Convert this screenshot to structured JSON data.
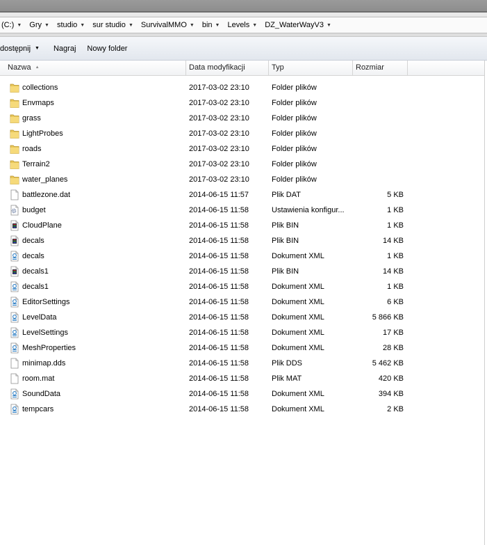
{
  "address": {
    "crumbs": [
      "(C:)",
      "Gry",
      "studio",
      "sur studio",
      "SurvivalMMO",
      "bin",
      "Levels",
      "DZ_WaterWayV3"
    ]
  },
  "toolbar": {
    "share_label": "dostępnij",
    "burn_label": "Nagraj",
    "new_folder_label": "Nowy folder"
  },
  "columns": {
    "name": "Nazwa",
    "date": "Data modyfikacji",
    "type": "Typ",
    "size": "Rozmiar"
  },
  "files": [
    {
      "name": "collections",
      "date": "2017-03-02 23:10",
      "type": "Folder plików",
      "size": "",
      "icon": "folder-icon"
    },
    {
      "name": "Envmaps",
      "date": "2017-03-02 23:10",
      "type": "Folder plików",
      "size": "",
      "icon": "folder-icon"
    },
    {
      "name": "grass",
      "date": "2017-03-02 23:10",
      "type": "Folder plików",
      "size": "",
      "icon": "folder-icon"
    },
    {
      "name": "LightProbes",
      "date": "2017-03-02 23:10",
      "type": "Folder plików",
      "size": "",
      "icon": "folder-icon"
    },
    {
      "name": "roads",
      "date": "2017-03-02 23:10",
      "type": "Folder plików",
      "size": "",
      "icon": "folder-icon"
    },
    {
      "name": "Terrain2",
      "date": "2017-03-02 23:10",
      "type": "Folder plików",
      "size": "",
      "icon": "folder-icon"
    },
    {
      "name": "water_planes",
      "date": "2017-03-02 23:10",
      "type": "Folder plików",
      "size": "",
      "icon": "folder-icon"
    },
    {
      "name": "battlezone.dat",
      "date": "2014-06-15 11:57",
      "type": "Plik DAT",
      "size": "5 KB",
      "icon": "file-icon"
    },
    {
      "name": "budget",
      "date": "2014-06-15 11:58",
      "type": "Ustawienia konfigur...",
      "size": "1 KB",
      "icon": "config-file-icon"
    },
    {
      "name": "CloudPlane",
      "date": "2014-06-15 11:58",
      "type": "Plik BIN",
      "size": "1 KB",
      "icon": "bin-file-icon"
    },
    {
      "name": "decals",
      "date": "2014-06-15 11:58",
      "type": "Plik BIN",
      "size": "14 KB",
      "icon": "bin-file-icon"
    },
    {
      "name": "decals",
      "date": "2014-06-15 11:58",
      "type": "Dokument XML",
      "size": "1 KB",
      "icon": "xml-file-icon"
    },
    {
      "name": "decals1",
      "date": "2014-06-15 11:58",
      "type": "Plik BIN",
      "size": "14 KB",
      "icon": "bin-file-icon"
    },
    {
      "name": "decals1",
      "date": "2014-06-15 11:58",
      "type": "Dokument XML",
      "size": "1 KB",
      "icon": "xml-file-icon"
    },
    {
      "name": "EditorSettings",
      "date": "2014-06-15 11:58",
      "type": "Dokument XML",
      "size": "6 KB",
      "icon": "xml-file-icon"
    },
    {
      "name": "LevelData",
      "date": "2014-06-15 11:58",
      "type": "Dokument XML",
      "size": "5 866 KB",
      "icon": "xml-file-icon"
    },
    {
      "name": "LevelSettings",
      "date": "2014-06-15 11:58",
      "type": "Dokument XML",
      "size": "17 KB",
      "icon": "xml-file-icon"
    },
    {
      "name": "MeshProperties",
      "date": "2014-06-15 11:58",
      "type": "Dokument XML",
      "size": "28 KB",
      "icon": "xml-file-icon"
    },
    {
      "name": "minimap.dds",
      "date": "2014-06-15 11:58",
      "type": "Plik DDS",
      "size": "5 462 KB",
      "icon": "file-icon"
    },
    {
      "name": "room.mat",
      "date": "2014-06-15 11:58",
      "type": "Plik MAT",
      "size": "420 KB",
      "icon": "file-icon"
    },
    {
      "name": "SoundData",
      "date": "2014-06-15 11:58",
      "type": "Dokument XML",
      "size": "394 KB",
      "icon": "xml-file-icon"
    },
    {
      "name": "tempcars",
      "date": "2014-06-15 11:58",
      "type": "Dokument XML",
      "size": "2 KB",
      "icon": "xml-file-icon"
    }
  ]
}
